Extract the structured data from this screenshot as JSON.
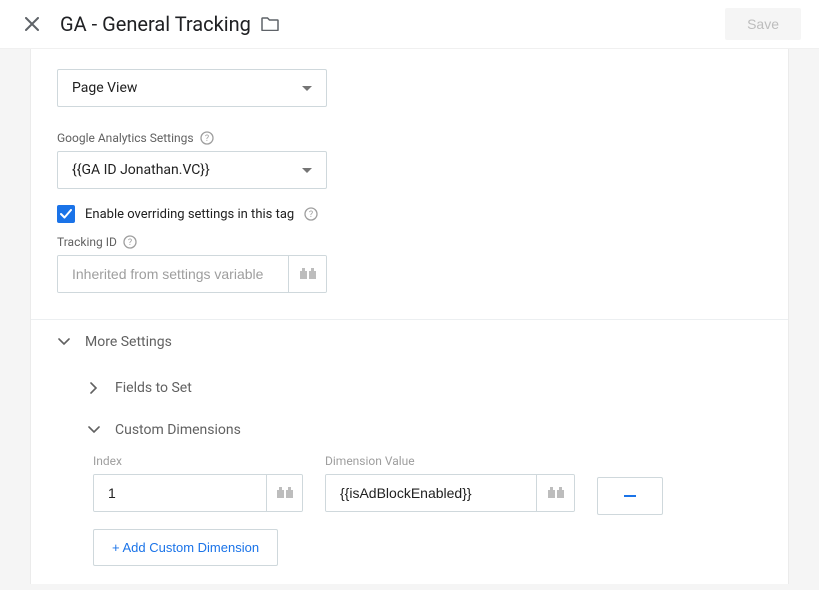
{
  "header": {
    "title": "GA - General Tracking",
    "save_label": "Save"
  },
  "track_type": {
    "value": "Page View"
  },
  "ga_settings": {
    "label": "Google Analytics Settings",
    "value": "{{GA ID Jonathan.VC}}"
  },
  "override": {
    "label": "Enable overriding settings in this tag",
    "checked": true
  },
  "tracking_id": {
    "label": "Tracking ID",
    "placeholder": "Inherited from settings variable",
    "value": ""
  },
  "sections": {
    "more_settings": "More Settings",
    "fields_to_set": "Fields to Set",
    "custom_dimensions": "Custom Dimensions"
  },
  "custom_dimensions": {
    "index_label": "Index",
    "value_label": "Dimension Value",
    "rows": [
      {
        "index": "1",
        "value": "{{isAdBlockEnabled}}"
      }
    ],
    "add_label": "+ Add Custom Dimension"
  }
}
